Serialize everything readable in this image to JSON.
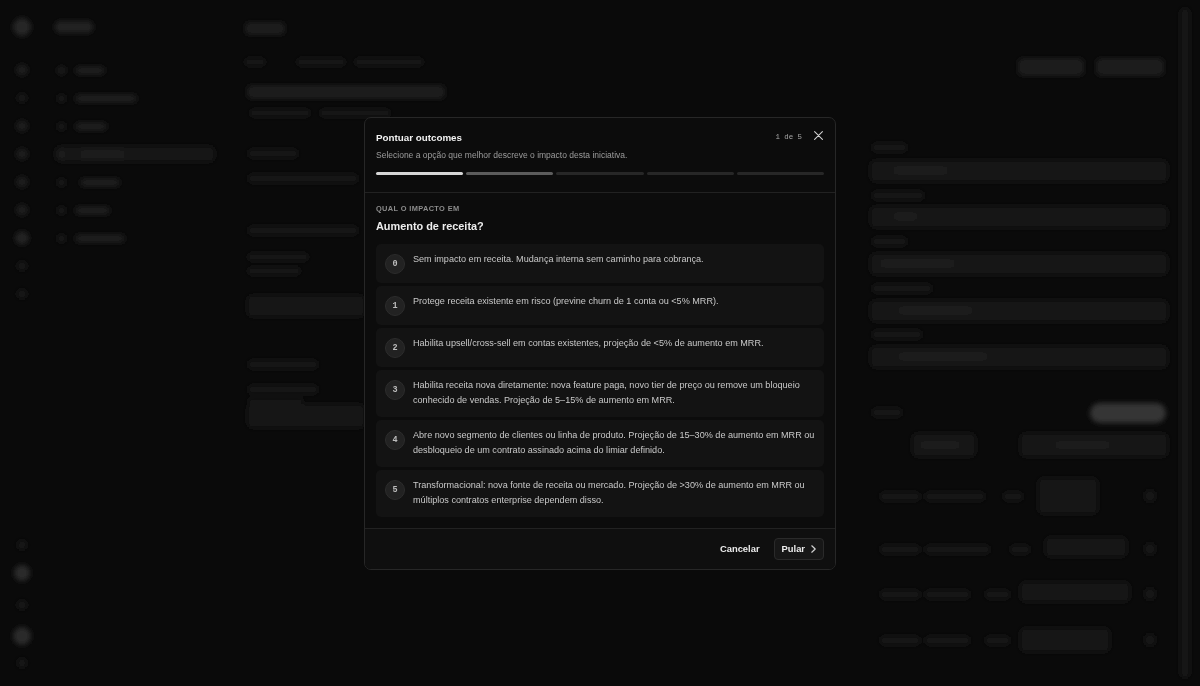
{
  "dialog": {
    "title": "Pontuar outcomes",
    "subtitle": "Selecione a opção que melhor descreve o impacto desta iniciativa.",
    "step_counter": "1 de 5",
    "progress_segments": [
      {
        "color": "#d6d6d6"
      },
      {
        "color": "#5c5c5c"
      },
      {
        "color": "#272727"
      },
      {
        "color": "#272727"
      },
      {
        "color": "#272727"
      }
    ],
    "question": {
      "eyebrow": "QUAL O IMPACTO EM",
      "text": "Aumento de receita?"
    },
    "options": [
      {
        "score": "0",
        "text": "Sem impacto em receita. Mudança interna sem caminho para cobrança.",
        "selected": false
      },
      {
        "score": "1",
        "text": "Protege receita existente em risco (previne churn de 1 conta ou <5% MRR).",
        "selected": false
      },
      {
        "score": "2",
        "text": "Habilita upsell/cross-sell em contas existentes, projeção de <5% de aumento em MRR.",
        "selected": false
      },
      {
        "score": "3",
        "text": "Habilita receita nova diretamente: nova feature paga, novo tier de preço ou remove um bloqueio conhecido de vendas. Projeção de 5–15% de aumento em MRR.",
        "selected": false
      },
      {
        "score": "4",
        "text": "Abre novo segmento de clientes ou linha de produto. Projeção de 15–30% de aumento em MRR ou desbloqueio de um contrato assinado acima do limiar definido.",
        "selected": false
      },
      {
        "score": "5",
        "text": "Transformacional: nova fonte de receita ou mercado. Projeção de >30% de aumento em MRR ou múltiplos contratos enterprise dependem disso.",
        "selected": false
      }
    ],
    "buttons": [
      {
        "kind": "ghost",
        "label": "Cancelar"
      },
      {
        "kind": "forward",
        "label": "Pular"
      }
    ]
  }
}
